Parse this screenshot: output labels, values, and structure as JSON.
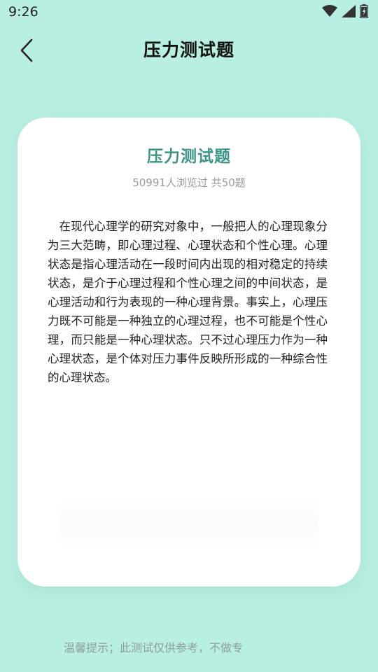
{
  "status_bar": {
    "time": "9:26",
    "icons": [
      "wifi-icon",
      "signal-icon",
      "battery-icon"
    ]
  },
  "header": {
    "title": "压力测试题",
    "back_icon": "chevron-left-icon"
  },
  "card": {
    "title": "压力测试题",
    "meta": "50991人浏览过 共50题",
    "description": "在现代心理学的研究对象中，一般把人的心理现象分为三大范畴，即心理过程、心理状态和个性心理。心理状态是指心理活动在一段时间内出现的相对稳定的持续状态，是介于心理过程和个性心理之间的中间状态，是心理活动和行为表现的一种心理背景。事实上，心理压力既不可能是一种独立的心理过程，也不可能是个性心理，而只能是一种心理状态。只不过心理压力作为一种心理状态，是个体对压力事件反映所形成的一种综合性的心理状态。"
  },
  "footer": {
    "tip": "温馨提示；此测试仅供参考，不做专"
  },
  "colors": {
    "background": "#b9efe2",
    "card_title": "#3a9588",
    "card_background": "#ffffff"
  }
}
